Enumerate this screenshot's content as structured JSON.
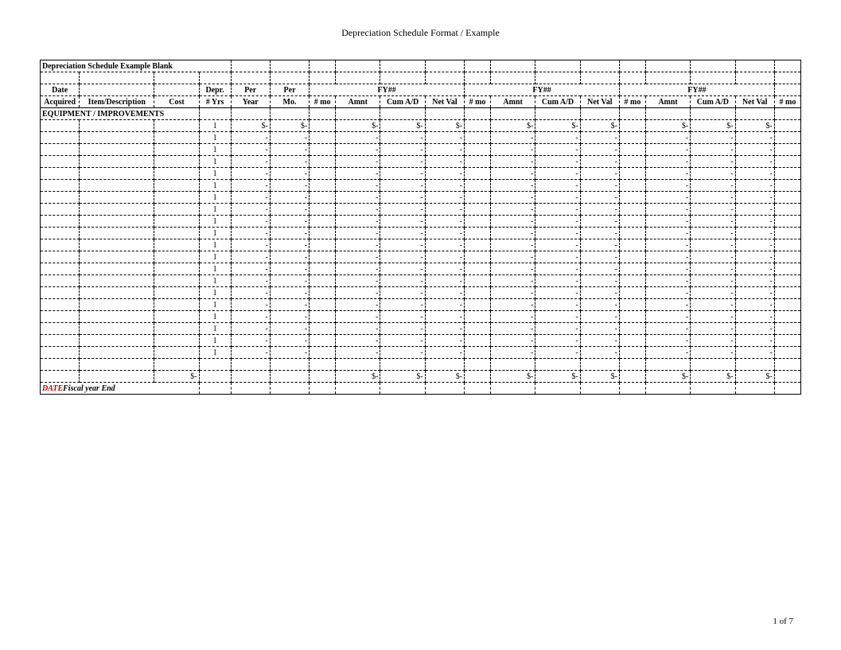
{
  "title": "Depreciation Schedule Format / Example",
  "sheet_title": "Depreciation Schedule Example Blank",
  "h": {
    "date": "Date",
    "depr": "Depr.",
    "per1": "Per",
    "per2": "Per",
    "fy": "FY##",
    "acquired": "Acquired",
    "item": "Item/Description",
    "cost": "Cost",
    "yrs": "# Yrs",
    "year": "Year",
    "mo": "Mo.",
    "nmo": "# mo",
    "amnt": "Amnt",
    "cad": "Cum A/D",
    "nv": "Net Val"
  },
  "section": "EQUIPMENT / IMPROVEMENTS",
  "yrs_val": "1",
  "dash": "-",
  "dollar": "$-",
  "footer_date": "DATE",
  "footer_text": "Fiscal year End",
  "page_no": "1 of 7",
  "num_rows": 20
}
